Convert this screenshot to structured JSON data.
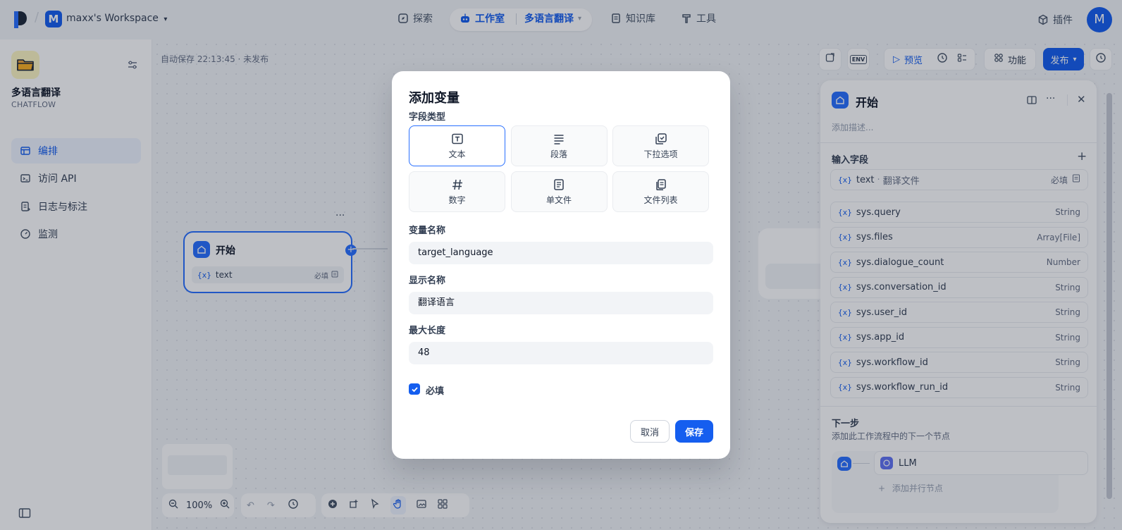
{
  "topbar": {
    "workspace_initial": "M",
    "workspace_name": "maxx's Workspace",
    "nav": {
      "explore": "探索",
      "studio": "工作室",
      "app_name": "多语言翻译",
      "knowledge": "知识库",
      "tools": "工具"
    },
    "plugins": "插件",
    "user_initial": "M"
  },
  "sidebar": {
    "app_name": "多语言翻译",
    "app_type": "CHATFLOW",
    "items": [
      {
        "label": "编排",
        "icon": "layout-icon"
      },
      {
        "label": "访问 API",
        "icon": "terminal-icon"
      },
      {
        "label": "日志与标注",
        "icon": "file-list-icon"
      },
      {
        "label": "监测",
        "icon": "dashboard-icon"
      }
    ]
  },
  "canvas": {
    "autosave": "自动保存 22:13:45 · 未发布",
    "toolbar": {
      "preview": "预览",
      "features": "功能",
      "publish": "发布"
    },
    "start_node": {
      "title": "开始",
      "var_name": "text",
      "required": "必填"
    },
    "zoom": "100%"
  },
  "right_panel": {
    "title": "开始",
    "desc_placeholder": "添加描述...",
    "input_fields_label": "输入字段",
    "input_field": {
      "name": "text",
      "sep": "·",
      "label": "翻译文件",
      "required": "必填"
    },
    "sys_vars": [
      {
        "name": "sys.query",
        "type": "String"
      },
      {
        "name": "sys.files",
        "type": "Array[File]"
      },
      {
        "name": "sys.dialogue_count",
        "type": "Number"
      },
      {
        "name": "sys.conversation_id",
        "type": "String"
      },
      {
        "name": "sys.user_id",
        "type": "String"
      },
      {
        "name": "sys.app_id",
        "type": "String"
      },
      {
        "name": "sys.workflow_id",
        "type": "String"
      },
      {
        "name": "sys.workflow_run_id",
        "type": "String"
      }
    ],
    "next_step": {
      "title": "下一步",
      "desc": "添加此工作流程中的下一个节点",
      "llm": "LLM",
      "add_parallel": "添加并行节点"
    }
  },
  "modal": {
    "title": "添加变量",
    "field_type_label": "字段类型",
    "types": [
      {
        "label": "文本",
        "icon": "text-input-icon",
        "selected": true
      },
      {
        "label": "段落",
        "icon": "paragraph-icon",
        "selected": false
      },
      {
        "label": "下拉选项",
        "icon": "dropdown-options-icon",
        "selected": false
      },
      {
        "label": "数字",
        "icon": "hash-icon",
        "selected": false
      },
      {
        "label": "单文件",
        "icon": "file-icon",
        "selected": false
      },
      {
        "label": "文件列表",
        "icon": "file-list-icon",
        "selected": false
      }
    ],
    "var_name_label": "变量名称",
    "var_name_value": "target_language",
    "display_name_label": "显示名称",
    "display_name_value": "翻译语言",
    "max_length_label": "最大长度",
    "max_length_value": "48",
    "required_label": "必填",
    "required_checked": true,
    "cancel": "取消",
    "save": "保存"
  },
  "colors": {
    "accent": "#155eef",
    "overlay": "rgba(16,24,40,0.27)"
  }
}
